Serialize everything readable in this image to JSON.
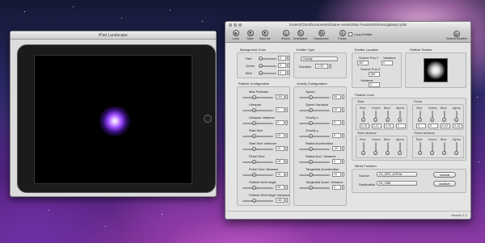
{
  "ipad_window": {
    "title": "iPad Landscape"
  },
  "designer_window": {
    "title": "/Users/Chris/Documents/Game Assets/Star Fusion/HD/misc/galaxy2.plist",
    "toolbar": {
      "buttons": [
        {
          "id": "load",
          "label": "Load",
          "icon": "load-icon"
        },
        {
          "id": "save",
          "label": "Save",
          "icon": "save-icon"
        },
        {
          "id": "save-as",
          "label": "Save As",
          "icon": "save-as-icon"
        },
        {
          "id": "iphone",
          "label": "iPhone",
          "icon": "iphone-icon"
        },
        {
          "id": "orientation",
          "label": "Orientation",
          "icon": "orientation-icon"
        },
        {
          "id": "randomize",
          "label": "Randomize",
          "icon": "randomize-icon"
        },
        {
          "id": "pause",
          "label": "Pause",
          "icon": "pause-icon"
        }
      ],
      "loop_emitter_label": "Loop Emitter",
      "shared_emitters_label": "Shared Emitters"
    },
    "background_color": {
      "title": "Background Color",
      "rows": [
        {
          "label": "Red",
          "value": "0"
        },
        {
          "label": "Green",
          "value": "0"
        },
        {
          "label": "Blue",
          "value": "0"
        }
      ]
    },
    "emitter_type": {
      "title": "Emitter Type",
      "selected": "Gravity",
      "duration_label": "Duration",
      "duration_value": "-1.00"
    },
    "emitter_location": {
      "title": "Emitter Location",
      "source_pos_y_label": "Source Pos Y",
      "source_pos_y_value": "487",
      "source_pos_x_label": "Source Pos X",
      "source_pos_x_value": "368",
      "variance_label": "Variance",
      "variance_y_value": "0",
      "variance_x_label": "Variance",
      "variance_x_value": "0"
    },
    "particle_texture": {
      "title": "Particle Texture"
    },
    "particle_configuration": {
      "title": "Particle Configuration",
      "rows": [
        {
          "label": "Max Particles",
          "value": "100"
        },
        {
          "label": "Lifespan",
          "value": "1"
        },
        {
          "label": "Lifespan Variance",
          "value": "0"
        },
        {
          "label": "Start Size",
          "value": "32"
        },
        {
          "label": "Start Size Variance",
          "value": "10"
        },
        {
          "label": "Finish Size",
          "value": "28"
        },
        {
          "label": "Finish Size Variance",
          "value": "10"
        },
        {
          "label": "Particle Emit Angle",
          "value": "90"
        },
        {
          "label": "Particle Emit Angle Variance",
          "value": "180"
        }
      ]
    },
    "gravity_configuration": {
      "title": "Gravity Configuration",
      "rows": [
        {
          "label": "Speed",
          "value": "50"
        },
        {
          "label": "Speed Variance",
          "value": "10"
        },
        {
          "label": "Gravity x",
          "value": "0"
        },
        {
          "label": "Gravity y",
          "value": "0"
        },
        {
          "label": "Radial Acceleration",
          "value": "-20"
        },
        {
          "label": "Radial Accl. Variance",
          "value": "0"
        },
        {
          "label": "Tangential Acceleration",
          "value": "10"
        },
        {
          "label": "Tangential Accel. Variance",
          "value": "0"
        }
      ]
    },
    "particle_color": {
      "title": "Particle Color",
      "start": {
        "title": "Start",
        "headers": [
          "Red",
          "Green",
          "Blue",
          "Alpha"
        ],
        "values": [
          "0.18",
          "0.21",
          "0.76",
          "1"
        ]
      },
      "finish": {
        "title": "Finish",
        "headers": [
          "Red",
          "Green",
          "Blue",
          "Alpha"
        ],
        "values": [
          "0",
          "0",
          "0.42",
          "0.18"
        ]
      },
      "start_variance": {
        "title": "Start Variance",
        "headers": [
          "Red",
          "Green",
          "Blue",
          "Alpha"
        ]
      },
      "finish_variance": {
        "title": "Finish Variance",
        "headers": [
          "Red",
          "Green",
          "Blue",
          "Alpha"
        ]
      }
    },
    "blend_function": {
      "title": "Blend Function",
      "source_label": "Source",
      "source_value": "GL_SRC_ALPHA",
      "destination_label": "Destination",
      "destination_value": "GL_ONE",
      "normal_label": "Normal",
      "additive_label": "Additive"
    },
    "version": "Version 1.2"
  }
}
